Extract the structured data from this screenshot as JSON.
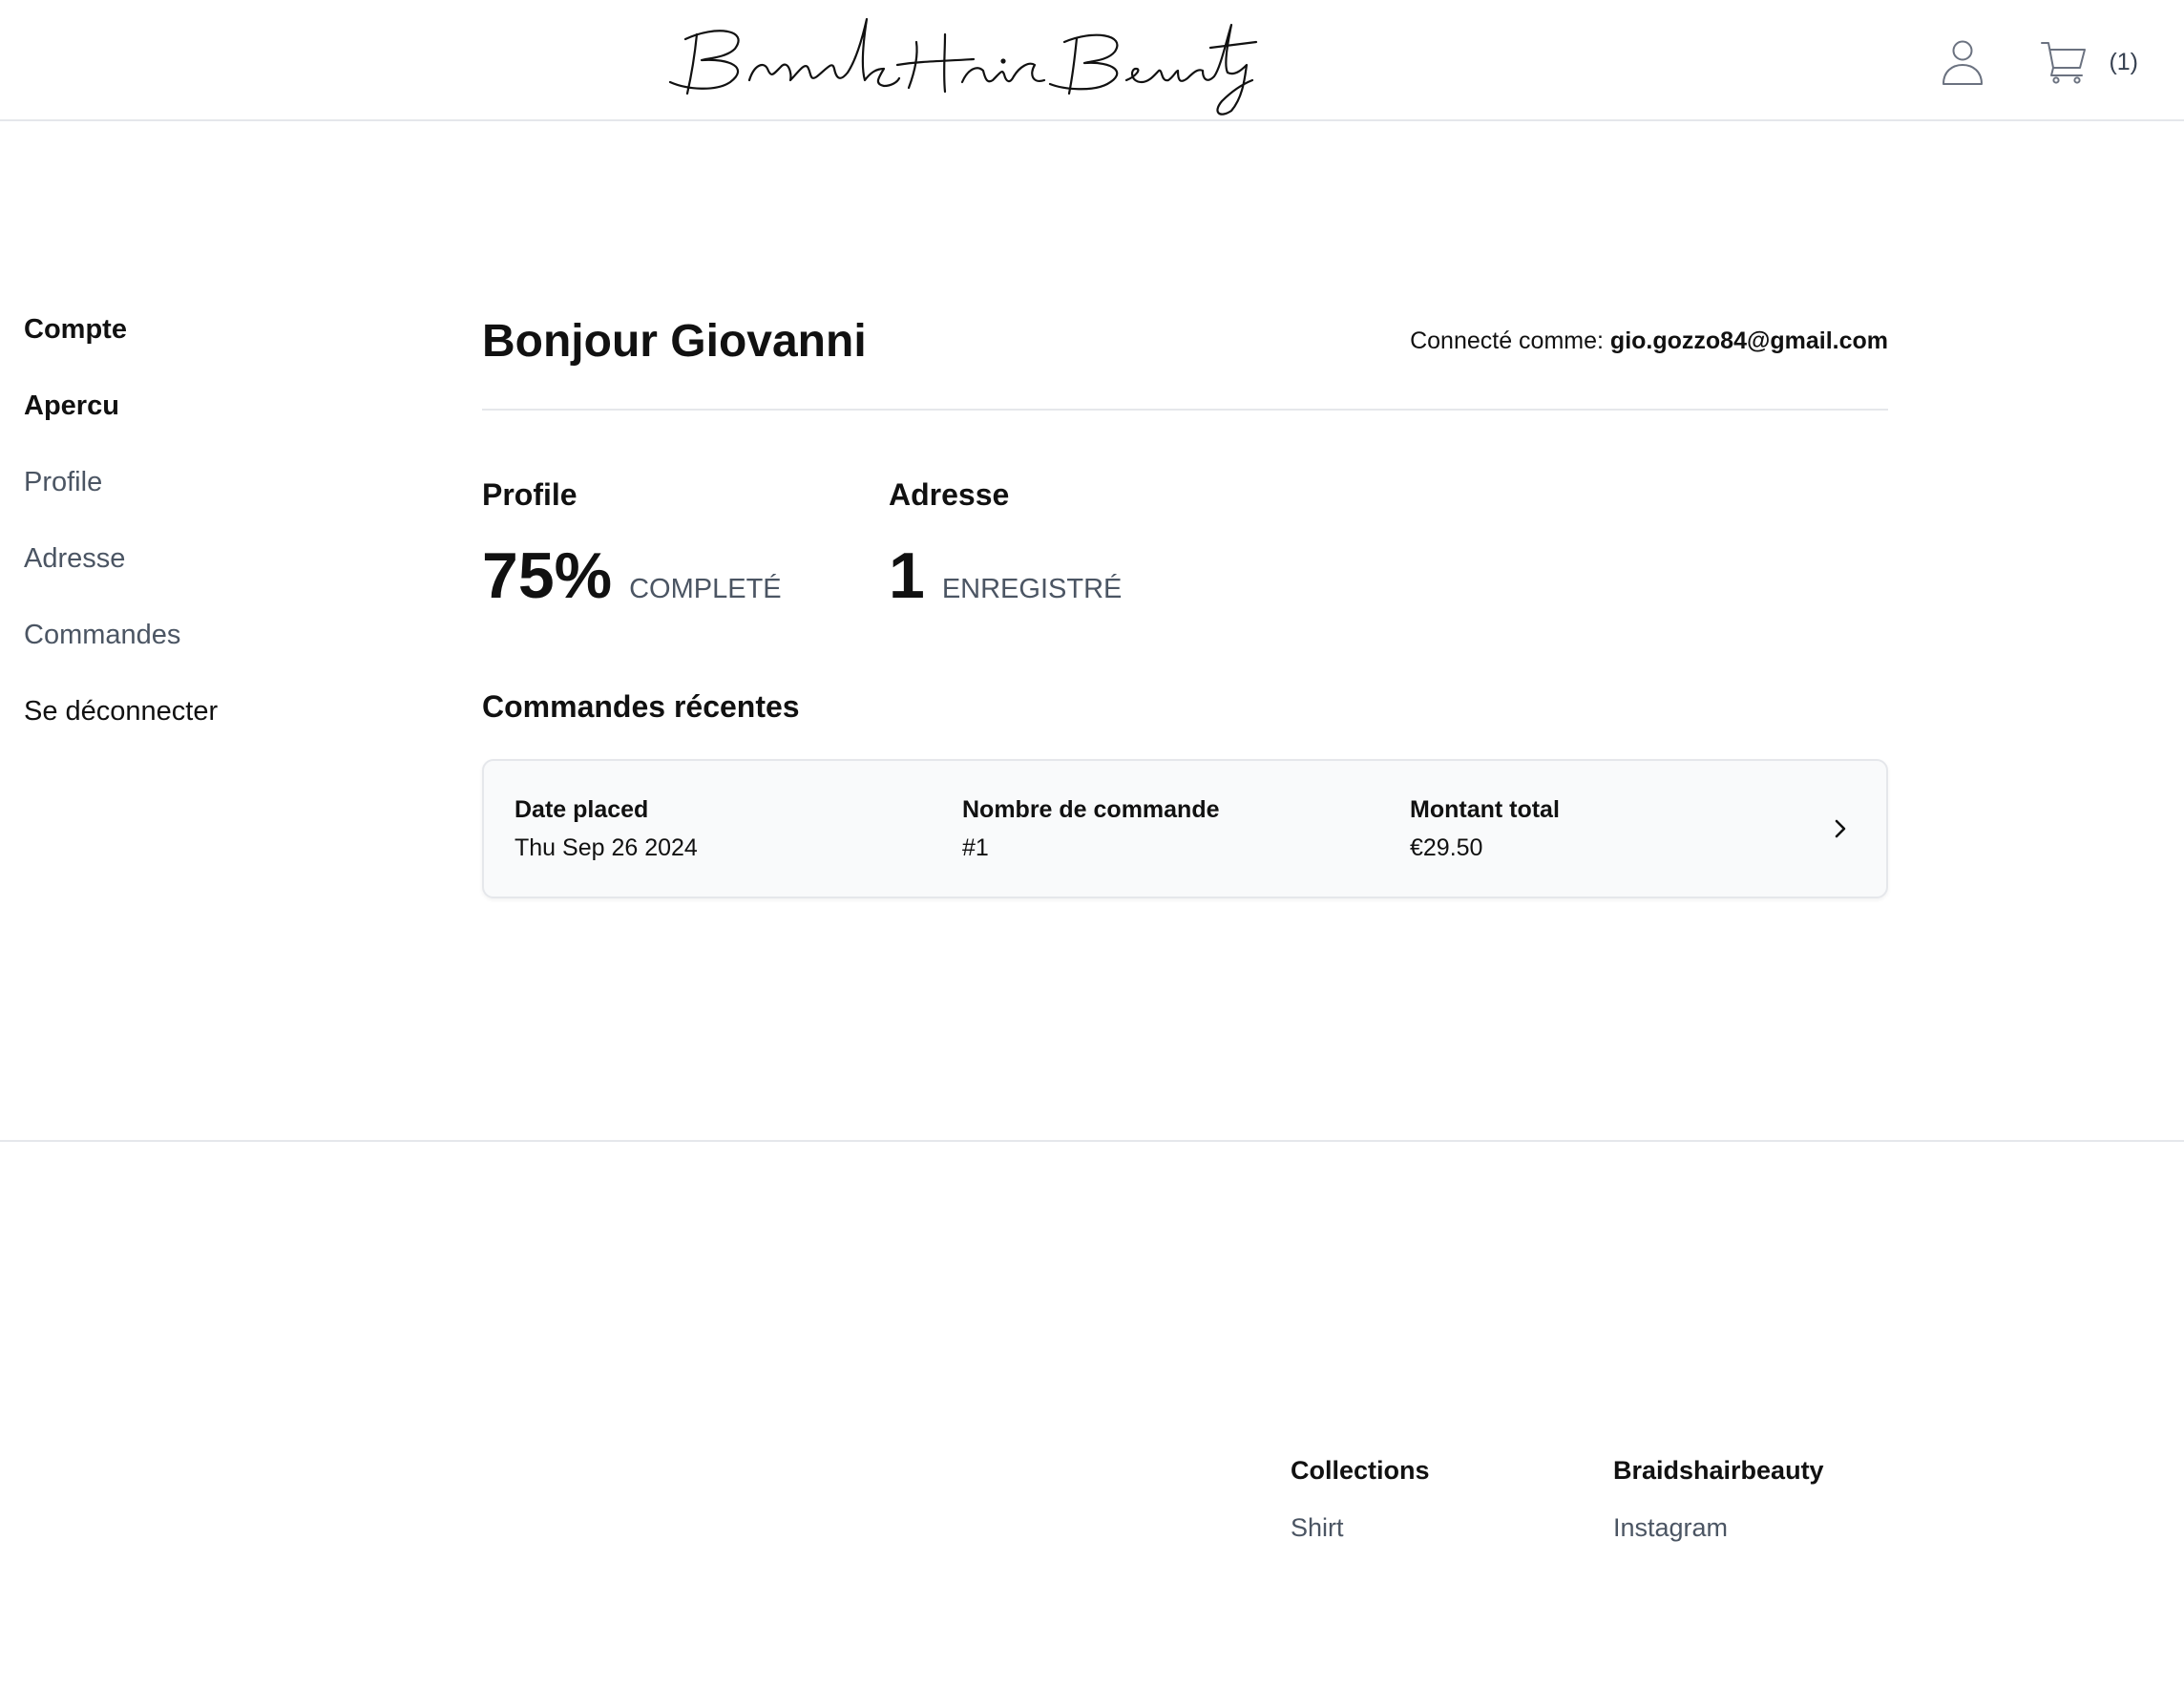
{
  "header": {
    "brand": "Braids Hair Beauty",
    "cart_count": "(1)",
    "icons": {
      "account": "user-icon",
      "cart": "cart-icon"
    }
  },
  "sidebar": {
    "heading": "Compte",
    "items": [
      {
        "label": "Apercu",
        "active": true
      },
      {
        "label": "Profile",
        "active": false
      },
      {
        "label": "Adresse",
        "active": false
      },
      {
        "label": "Commandes",
        "active": false
      },
      {
        "label": "Se déconnecter",
        "active": false
      }
    ]
  },
  "main": {
    "greeting": "Bonjour Giovanni",
    "signed_in_label": "Connecté comme:",
    "email": "gio.gozzo84@gmail.com",
    "stats": [
      {
        "title": "Profile",
        "value": "75%",
        "unit": "Completé"
      },
      {
        "title": "Adresse",
        "value": "1",
        "unit": "Enregistré"
      }
    ],
    "recent_orders_title": "Commandes récentes",
    "orders": [
      {
        "date_label": "Date placed",
        "date": "Thu Sep 26 2024",
        "number_label": "Nombre de commande",
        "number": "#1",
        "total_label": "Montant total",
        "total": "€29.50"
      }
    ]
  },
  "footer": {
    "columns": [
      {
        "title": "Collections",
        "links": [
          "Shirt"
        ]
      },
      {
        "title": "Braidshairbeauty",
        "links": [
          "Instagram"
        ]
      }
    ]
  },
  "colors": {
    "text": "#111111",
    "muted": "#4b5563",
    "border": "#e5e7eb",
    "card_bg": "#f9fafb"
  }
}
